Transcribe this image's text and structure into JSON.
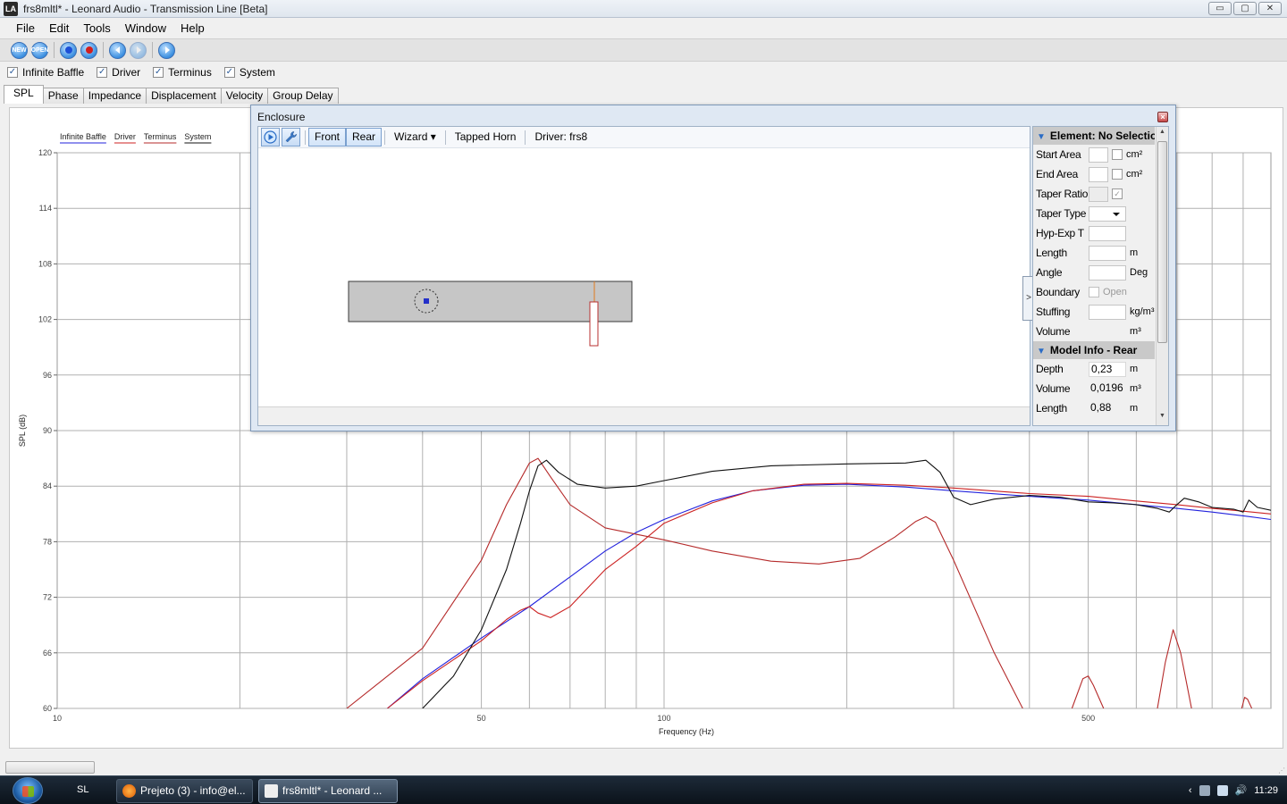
{
  "window": {
    "title": "frs8mltl* - Leonard Audio - Transmission Line [Beta]",
    "logo": "LA",
    "min_label": "▭",
    "max_label": "▢",
    "close_label": "✕"
  },
  "menu": [
    "File",
    "Edit",
    "Tools",
    "Window",
    "Help"
  ],
  "toolbar": {
    "icons": [
      "new-icon",
      "open-icon",
      "record-blue-icon",
      "record-red-icon",
      "step-back-icon",
      "step-forward-icon",
      "play-icon"
    ],
    "new_label": "NEW",
    "open_label": "OPEN"
  },
  "checkboxes": [
    {
      "label": "Infinite Baffle",
      "checked": true
    },
    {
      "label": "Driver",
      "checked": true
    },
    {
      "label": "Terminus",
      "checked": true
    },
    {
      "label": "System",
      "checked": true
    }
  ],
  "tabs": [
    "SPL",
    "Phase",
    "Impedance",
    "Displacement",
    "Velocity",
    "Group Delay"
  ],
  "active_tab": "SPL",
  "chart_data": {
    "type": "line",
    "xlabel": "Frequency (Hz)",
    "ylabel": "SPL (dB)",
    "xscale": "log",
    "xlim": [
      10,
      1000
    ],
    "ylim": [
      60,
      120
    ],
    "yticks": [
      60,
      66,
      72,
      78,
      84,
      90,
      96,
      102,
      108,
      114,
      120
    ],
    "xtick_labels": [
      {
        "x": 10,
        "label": "10"
      },
      {
        "x": 50,
        "label": "50"
      },
      {
        "x": 100,
        "label": "100"
      },
      {
        "x": 500,
        "label": "500"
      }
    ],
    "x_gridlines": [
      20,
      30,
      40,
      50,
      60,
      70,
      80,
      90,
      100,
      200,
      300,
      400,
      500,
      600,
      700,
      800,
      900
    ],
    "grid": true,
    "legend": [
      "Infinite Baffle",
      "Driver",
      "Terminus",
      "System"
    ],
    "series": [
      {
        "name": "Infinite Baffle",
        "color": "#2222dd",
        "points": [
          [
            35,
            60.0
          ],
          [
            40,
            63.2
          ],
          [
            50,
            67.6
          ],
          [
            60,
            71.0
          ],
          [
            70,
            74.2
          ],
          [
            80,
            77.0
          ],
          [
            90,
            79.0
          ],
          [
            100,
            80.4
          ],
          [
            120,
            82.4
          ],
          [
            140,
            83.5
          ],
          [
            170,
            84.1
          ],
          [
            200,
            84.2
          ],
          [
            250,
            83.9
          ],
          [
            300,
            83.5
          ],
          [
            400,
            82.9
          ],
          [
            500,
            82.5
          ],
          [
            600,
            82.0
          ],
          [
            700,
            81.6
          ],
          [
            800,
            81.2
          ],
          [
            900,
            80.8
          ],
          [
            1000,
            80.4
          ]
        ]
      },
      {
        "name": "Driver",
        "color": "#cc2222",
        "points": [
          [
            35,
            60.0
          ],
          [
            40,
            63.0
          ],
          [
            50,
            67.3
          ],
          [
            55,
            69.6
          ],
          [
            58,
            70.6
          ],
          [
            60,
            71.0
          ],
          [
            62,
            70.3
          ],
          [
            65,
            69.8
          ],
          [
            70,
            71.0
          ],
          [
            80,
            75.0
          ],
          [
            90,
            77.5
          ],
          [
            100,
            80.0
          ],
          [
            120,
            82.2
          ],
          [
            140,
            83.5
          ],
          [
            170,
            84.2
          ],
          [
            200,
            84.3
          ],
          [
            250,
            84.1
          ],
          [
            300,
            83.8
          ],
          [
            400,
            83.2
          ],
          [
            500,
            82.9
          ],
          [
            600,
            82.4
          ],
          [
            700,
            82.0
          ],
          [
            800,
            81.6
          ],
          [
            900,
            81.3
          ],
          [
            1000,
            81.0
          ]
        ]
      },
      {
        "name": "Terminus",
        "color": "#b52a2a",
        "segments": [
          [
            [
              30,
              60.0
            ],
            [
              40,
              66.5
            ],
            [
              50,
              76.0
            ],
            [
              55,
              82.0
            ],
            [
              60,
              86.5
            ],
            [
              62,
              87.0
            ],
            [
              65,
              85.0
            ],
            [
              70,
              82.0
            ],
            [
              80,
              79.5
            ],
            [
              90,
              78.8
            ],
            [
              100,
              78.2
            ],
            [
              120,
              77.0
            ],
            [
              150,
              75.9
            ],
            [
              180,
              75.6
            ],
            [
              210,
              76.2
            ],
            [
              240,
              78.5
            ],
            [
              260,
              80.2
            ],
            [
              270,
              80.7
            ],
            [
              280,
              80.1
            ],
            [
              300,
              76.0
            ],
            [
              350,
              66.0
            ],
            [
              390,
              60.0
            ]
          ],
          [
            [
              470,
              60.0
            ],
            [
              490,
              63.2
            ],
            [
              500,
              63.5
            ],
            [
              510,
              62.5
            ],
            [
              530,
              60.0
            ]
          ],
          [
            [
              650,
              60.0
            ],
            [
              670,
              65.0
            ],
            [
              690,
              68.5
            ],
            [
              710,
              66.0
            ],
            [
              740,
              60.0
            ]
          ],
          [
            [
              895,
              60.0
            ],
            [
              905,
              61.2
            ],
            [
              915,
              61.0
            ],
            [
              930,
              60.0
            ]
          ]
        ]
      },
      {
        "name": "System",
        "color": "#111111",
        "points": [
          [
            40,
            60.0
          ],
          [
            45,
            63.5
          ],
          [
            50,
            68.5
          ],
          [
            55,
            75.0
          ],
          [
            58,
            80.0
          ],
          [
            60,
            83.5
          ],
          [
            62,
            86.2
          ],
          [
            64,
            86.8
          ],
          [
            67,
            85.5
          ],
          [
            72,
            84.2
          ],
          [
            80,
            83.8
          ],
          [
            90,
            84.0
          ],
          [
            100,
            84.6
          ],
          [
            120,
            85.6
          ],
          [
            150,
            86.2
          ],
          [
            200,
            86.4
          ],
          [
            250,
            86.5
          ],
          [
            270,
            86.8
          ],
          [
            285,
            85.5
          ],
          [
            300,
            82.8
          ],
          [
            320,
            82.0
          ],
          [
            350,
            82.6
          ],
          [
            400,
            83.0
          ],
          [
            450,
            82.8
          ],
          [
            500,
            82.3
          ],
          [
            550,
            82.2
          ],
          [
            600,
            82.0
          ],
          [
            650,
            81.6
          ],
          [
            680,
            81.2
          ],
          [
            700,
            82.0
          ],
          [
            720,
            82.7
          ],
          [
            760,
            82.3
          ],
          [
            800,
            81.7
          ],
          [
            870,
            81.5
          ],
          [
            900,
            81.2
          ],
          [
            920,
            82.5
          ],
          [
            950,
            81.7
          ],
          [
            1000,
            81.4
          ]
        ]
      }
    ]
  },
  "enclosure": {
    "title": "Enclosure",
    "toolbar": {
      "front_label": "Front",
      "rear_label": "Rear",
      "wizard_label": "Wizard ▾",
      "type_label": "Tapped Horn",
      "driver_label": "Driver: frs8"
    },
    "side_tab_label": ">",
    "element_section": "Element: No Selection",
    "element_props": [
      {
        "label": "Start Area",
        "unit": "cm²",
        "kind": "field-check"
      },
      {
        "label": "End Area",
        "unit": "cm²",
        "kind": "field-check"
      },
      {
        "label": "Taper Ratio",
        "unit": "",
        "kind": "field-check-checked"
      },
      {
        "label": "Taper Type",
        "unit": "",
        "kind": "dropdown"
      },
      {
        "label": "Hyp-Exp T",
        "unit": "",
        "kind": "field"
      },
      {
        "label": "Length",
        "unit": "m",
        "kind": "field"
      },
      {
        "label": "Angle",
        "unit": "Deg",
        "kind": "field"
      },
      {
        "label": "Boundary",
        "unit": "",
        "kind": "open-check"
      },
      {
        "label": "Stuffing",
        "unit": "kg/m³",
        "kind": "field"
      },
      {
        "label": "Volume",
        "unit": "m³",
        "kind": "unit-only"
      }
    ],
    "open_label": "Open",
    "model_section": "Model Info - Rear",
    "model_props": [
      {
        "label": "Depth",
        "value": "0,23",
        "unit": "m"
      },
      {
        "label": "Volume",
        "value": "0,0196",
        "unit": "m³"
      },
      {
        "label": "Length",
        "value": "0,88",
        "unit": "m"
      }
    ]
  },
  "taskbar": {
    "lang": "SL",
    "tasks": [
      {
        "label": "Prejeto (3) - info@el...",
        "active": false
      },
      {
        "label": "frs8mltl* - Leonard ...",
        "active": true
      }
    ],
    "clock": "11:29"
  }
}
